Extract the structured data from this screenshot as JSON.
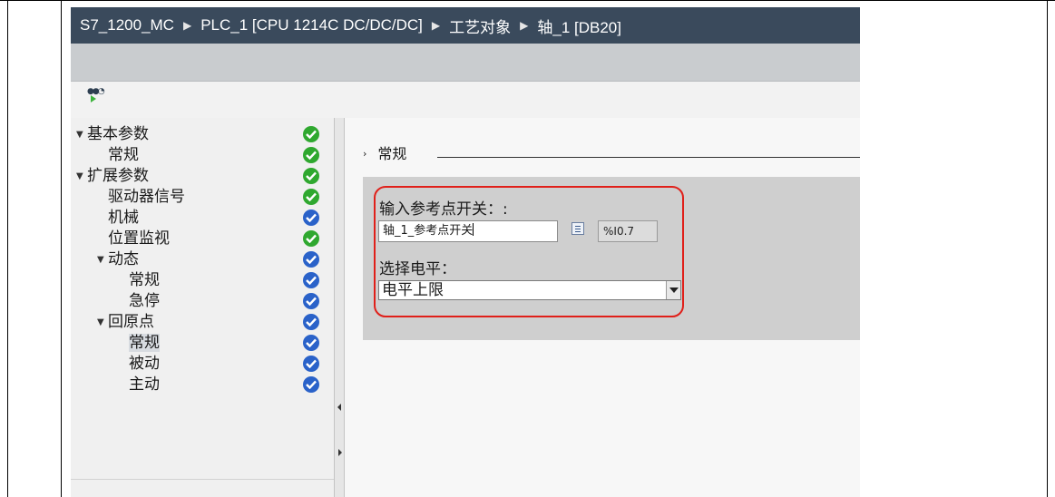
{
  "breadcrumb": [
    "S7_1200_MC",
    "PLC_1 [CPU 1214C DC/DC/DC]",
    "工艺对象",
    "轴_1 [DB20]"
  ],
  "tree": {
    "items": [
      {
        "label": "基本参数",
        "status": "green",
        "expanded": true
      },
      {
        "label": "常规",
        "status": "green"
      },
      {
        "label": "扩展参数",
        "status": "green",
        "expanded": true
      },
      {
        "label": "驱动器信号",
        "status": "green"
      },
      {
        "label": "机械",
        "status": "blue"
      },
      {
        "label": "位置监视",
        "status": "green"
      },
      {
        "label": "动态",
        "status": "blue",
        "expanded": true
      },
      {
        "label": "常规",
        "status": "blue"
      },
      {
        "label": "急停",
        "status": "blue"
      },
      {
        "label": "回原点",
        "status": "blue",
        "expanded": true
      },
      {
        "label": "常规",
        "status": "blue",
        "selected": true
      },
      {
        "label": "被动",
        "status": "blue"
      },
      {
        "label": "主动",
        "status": "blue"
      }
    ]
  },
  "content": {
    "section_title": "常规",
    "ref_switch_label": "输入参考点开关：:",
    "ref_switch_value": "轴_1_参考点开关",
    "ref_switch_address": "%I0.7",
    "level_label": "选择电平：",
    "level_value": "电平上限"
  },
  "colors": {
    "highlight_border": "#e0201a",
    "status_ok": "#2fa82f",
    "status_info": "#2a62c9",
    "breadcrumb_bg": "#3a4a5c"
  },
  "icons": {
    "tree_toggle": "toggle-tree-icon",
    "status": "checkmark-icon",
    "browse": "list-icon",
    "dropdown": "chevron-down-icon"
  }
}
